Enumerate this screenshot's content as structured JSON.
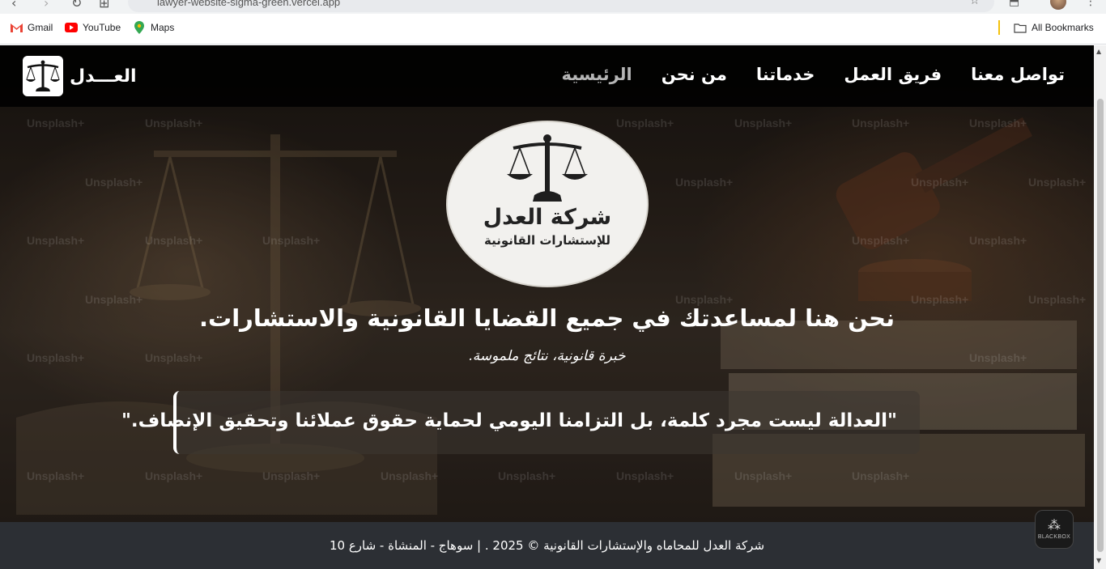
{
  "browser": {
    "url": "lawyer-website-sigma-green.vercel.app",
    "bookmarks": [
      {
        "label": "Gmail",
        "icon": "gmail-icon"
      },
      {
        "label": "YouTube",
        "icon": "youtube-icon"
      },
      {
        "label": "Maps",
        "icon": "maps-icon"
      }
    ],
    "all_bookmarks": "All Bookmarks"
  },
  "site": {
    "brand": "العـــدل",
    "nav": [
      {
        "label": "تواصل معنا",
        "active": false
      },
      {
        "label": "فريق العمل",
        "active": false
      },
      {
        "label": "خدماتنا",
        "active": false
      },
      {
        "label": "من نحن",
        "active": false
      },
      {
        "label": "الرئيسية",
        "active": true
      }
    ],
    "emblem_title": "شركة العدل",
    "emblem_subtitle": "للإستشارات القانونية",
    "headline": "نحن هنا لمساعدتك في جميع القضايا القانونية والاستشارات.",
    "tagline": "خبرة قانونية، نتائج ملموسة.",
    "quote": "\"العدالة ليست مجرد كلمة، بل التزامنا اليومي لحماية حقوق عملائنا وتحقيق الإنصاف.\"",
    "watermark": "Unsplash+",
    "footer": "شركة العدل للمحاماه والإستشارات القانونية © 2025 . | سوهاج - المنشاة - شارع 10",
    "widget_label": "BLACKBOX"
  },
  "colors": {
    "navbar": "#000000",
    "footer": "#2c2f34",
    "active_nav": "#b5b5b5"
  }
}
